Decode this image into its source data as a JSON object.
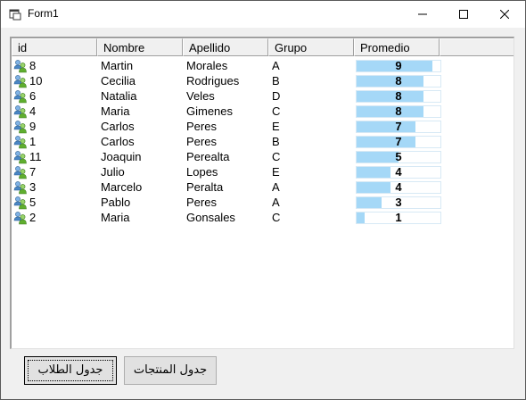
{
  "window": {
    "title": "Form1"
  },
  "listview": {
    "columns": [
      "id",
      "Nombre",
      "Apellido",
      "Grupo",
      "Promedio"
    ],
    "rows": [
      {
        "id": "8",
        "nombre": "Martin",
        "apellido": "Morales",
        "grupo": "A",
        "promedio": "9",
        "fill": 0.9
      },
      {
        "id": "10",
        "nombre": "Cecilia",
        "apellido": "Rodrigues",
        "grupo": "B",
        "promedio": "8",
        "fill": 0.8
      },
      {
        "id": "6",
        "nombre": "Natalia",
        "apellido": "Veles",
        "grupo": "D",
        "promedio": "8",
        "fill": 0.8
      },
      {
        "id": "4",
        "nombre": "Maria",
        "apellido": "Gimenes",
        "grupo": "C",
        "promedio": "8",
        "fill": 0.8
      },
      {
        "id": "9",
        "nombre": "Carlos",
        "apellido": "Peres",
        "grupo": "E",
        "promedio": "7",
        "fill": 0.7
      },
      {
        "id": "1",
        "nombre": "Carlos",
        "apellido": "Peres",
        "grupo": "B",
        "promedio": "7",
        "fill": 0.7
      },
      {
        "id": "11",
        "nombre": "Joaquin",
        "apellido": "Perealta",
        "grupo": "C",
        "promedio": "5",
        "fill": 0.5
      },
      {
        "id": "7",
        "nombre": "Julio",
        "apellido": "Lopes",
        "grupo": "E",
        "promedio": "4",
        "fill": 0.4
      },
      {
        "id": "3",
        "nombre": "Marcelo",
        "apellido": "Peralta",
        "grupo": "A",
        "promedio": "4",
        "fill": 0.4
      },
      {
        "id": "5",
        "nombre": "Pablo",
        "apellido": "Peres",
        "grupo": "A",
        "promedio": "3",
        "fill": 0.3
      },
      {
        "id": "2",
        "nombre": "Maria",
        "apellido": "Gonsales",
        "grupo": "C",
        "promedio": "1",
        "fill": 0.1
      }
    ]
  },
  "buttons": {
    "students": "جدول الطلاب",
    "products": "جدول المنتجات"
  },
  "icons": {
    "row": "users-icon",
    "app": "form-window-icon"
  },
  "colors": {
    "bar_fill": "#a5d8f7"
  }
}
